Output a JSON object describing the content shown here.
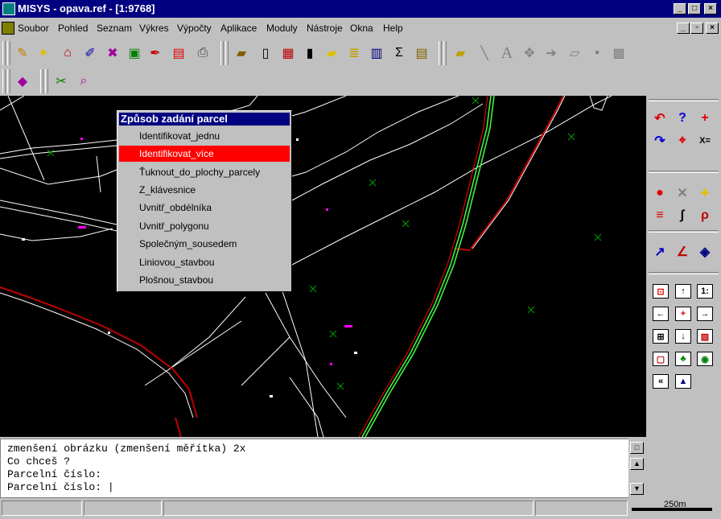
{
  "window": {
    "title": "MISYS - opava.ref - [1:9768]"
  },
  "menu": [
    "Soubor",
    "Pohled",
    "Seznam",
    "Výkres",
    "Výpočty",
    "Aplikace",
    "Moduly",
    "Nástroje",
    "Okna",
    "Help"
  ],
  "popup": {
    "title": "Způsob zadání parcel",
    "items": [
      "Identifikovat_jednu",
      "Identifikovat_více",
      "Ťuknout_do_plochy_parcely",
      "Z_klávesnice",
      "Uvnitř_obdélníka",
      "Uvnitř_polygonu",
      "Společným_sousedem",
      "Liniovou_stavbou",
      "Plošnou_stavbou"
    ],
    "selected_index": 1
  },
  "command": {
    "lines": [
      "zmenšení obrázku (zmenšení měřítka) 2x",
      "Co chceš ?",
      "Parcelní číslo:",
      "Parcelní číslo: |"
    ]
  },
  "status": {
    "scale_label": "250m"
  },
  "icons": {
    "toolbar1": [
      "new-doc-icon",
      "flashlight-icon",
      "house-icon",
      "edit-map-icon",
      "cross-icon",
      "parcel-icon",
      "pen-icon",
      "layers-icon",
      "print-icon"
    ],
    "toolbar2": [
      "open-icon",
      "doc-icon",
      "building-icon",
      "doc2-icon",
      "folder-icon",
      "scroll-icon",
      "book-icon",
      "sigma-icon",
      "report-icon"
    ],
    "toolbar3": [
      "open-folder-icon",
      "line-icon",
      "text-icon",
      "point-icon",
      "move-icon",
      "erase-icon",
      "save-icon",
      "layer-icon"
    ],
    "toolbar4": [
      "layer-select-icon",
      "zoom-tools-icon"
    ]
  },
  "colors": {
    "selection": "#ff0000",
    "titlebar": "#000080",
    "map": "#000000"
  }
}
